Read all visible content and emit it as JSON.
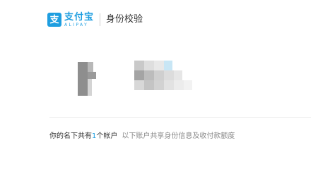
{
  "colors": {
    "brand_blue": "#1e9ee0",
    "divider": "#cccccc",
    "text": "#333333",
    "muted": "#888888",
    "count": "#1e9ee0"
  },
  "header": {
    "logo_glyph": "支",
    "brand_name": "支付宝",
    "brand_sub": "ALIPAY",
    "page_title": "身份校验"
  },
  "account": {
    "blurred": true
  },
  "summary": {
    "prefix": "你的名下共有",
    "count": "1",
    "suffix": "个帐户",
    "description": "以下账户共享身份信息及收付款额度"
  }
}
